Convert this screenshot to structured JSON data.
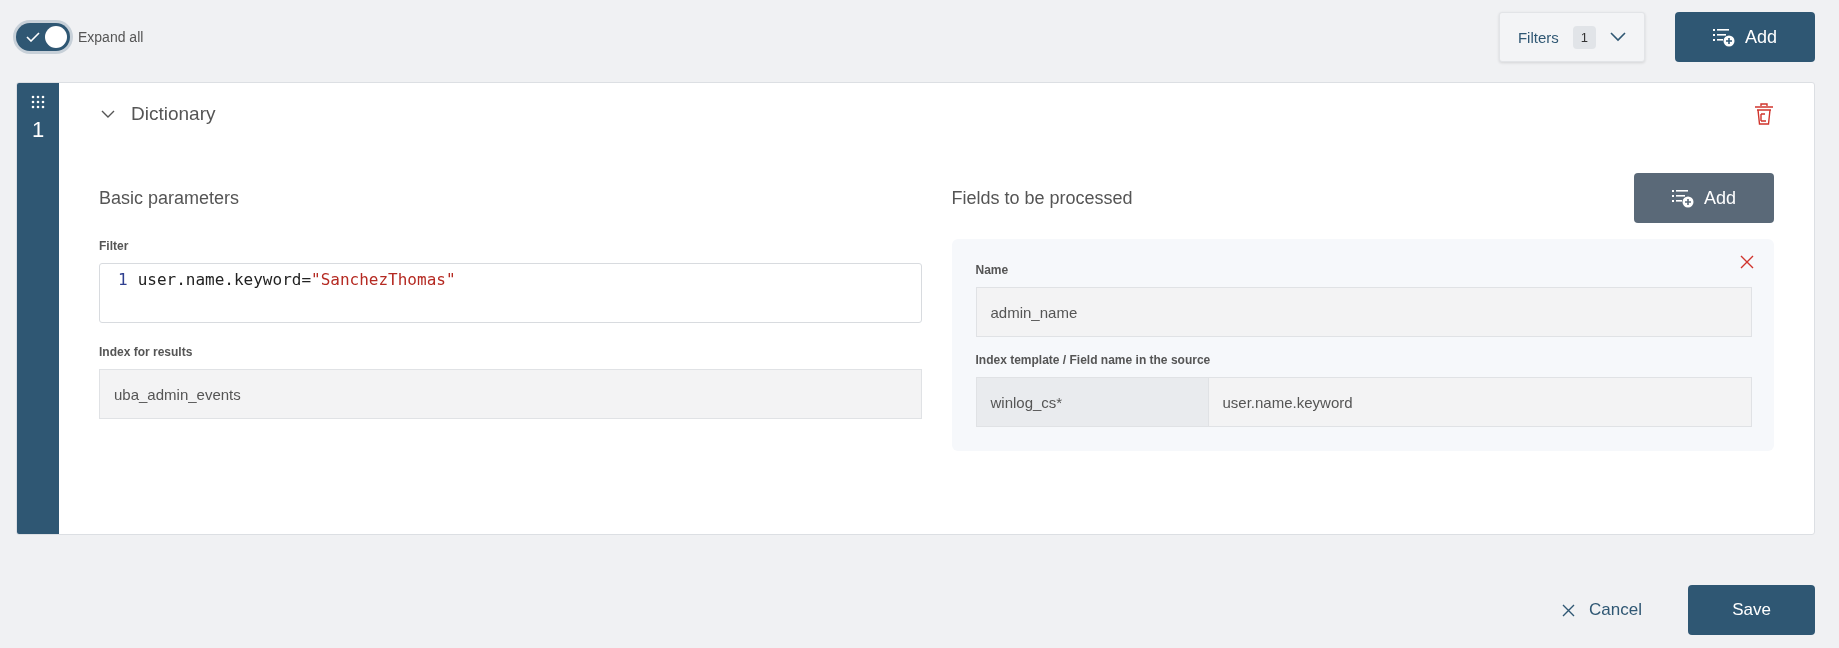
{
  "expand_all": {
    "label": "Expand all",
    "on": true
  },
  "filters": {
    "label": "Filters",
    "count": "1"
  },
  "add_button": "Add",
  "rules": [
    {
      "number": "1",
      "title": "Dictionary",
      "expanded": true,
      "basic": {
        "heading": "Basic parameters",
        "filter_label": "Filter",
        "filter_lines": [
          {
            "number": "1",
            "key": "user.name.keyword=",
            "value": "\"SanchezThomas\""
          }
        ],
        "index_label": "Index for results",
        "index_value": "uba_admin_events"
      },
      "fields": {
        "heading": "Fields to be processed",
        "add_button": "Add",
        "items": [
          {
            "name_label": "Name",
            "name_value": "admin_name",
            "source_label": "Index template / Field name in the source",
            "index_template": "winlog_cs*",
            "field_name": "user.name.keyword"
          }
        ]
      }
    }
  ],
  "footer": {
    "cancel": "Cancel",
    "save": "Save"
  }
}
